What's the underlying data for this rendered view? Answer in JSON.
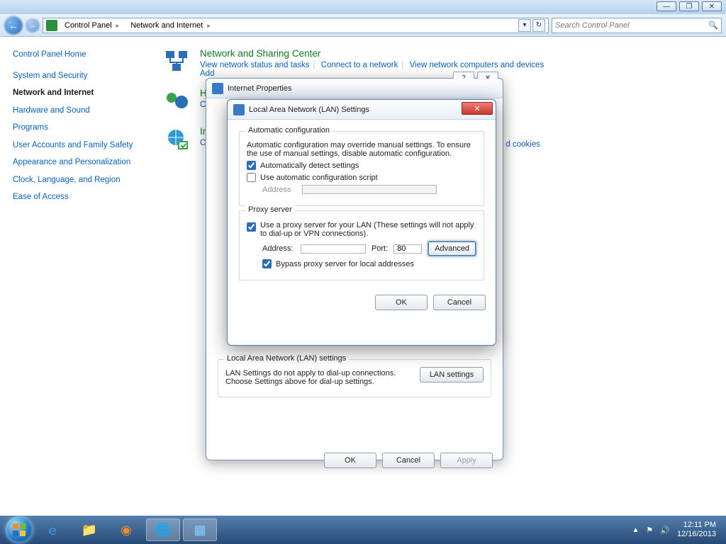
{
  "window": {
    "breadcrumbs": [
      "Control Panel",
      "Network and Internet"
    ],
    "search_placeholder": "Search Control Panel"
  },
  "sidebar": {
    "home": "Control Panel Home",
    "items": [
      "System and Security",
      "Network and Internet",
      "Hardware and Sound",
      "Programs",
      "User Accounts and Family Safety",
      "Appearance and Personalization",
      "Clock, Language, and Region",
      "Ease of Access"
    ],
    "current_index": 1
  },
  "categories": {
    "nsc": {
      "title": "Network and Sharing Center",
      "links": [
        "View network status and tasks",
        "Connect to a network",
        "View network computers and devices",
        "Add"
      ]
    },
    "homegroup": {
      "title_visible": "Ho",
      "link_visible": "Choo"
    },
    "internet": {
      "title_visible": "Inte",
      "link_visible": "Chan",
      "trailing": "d cookies"
    }
  },
  "ip_dialog": {
    "title": "Internet Properties",
    "lan_group_title": "Local Area Network (LAN) settings",
    "lan_text": "LAN Settings do not apply to dial-up connections. Choose Settings above for dial-up settings.",
    "lan_button": "LAN settings",
    "ok": "OK",
    "cancel": "Cancel",
    "apply": "Apply",
    "help": "?",
    "close": "✕"
  },
  "lan_dialog": {
    "title": "Local Area Network (LAN) Settings",
    "auto": {
      "group": "Automatic configuration",
      "text": "Automatic configuration may override manual settings.  To ensure the use of manual settings, disable automatic configuration.",
      "detect": {
        "label": "Automatically detect settings",
        "checked": true
      },
      "script": {
        "label": "Use automatic configuration script",
        "checked": false
      },
      "addr_label": "Address",
      "addr_value": ""
    },
    "proxy": {
      "group": "Proxy server",
      "use": {
        "label": "Use a proxy server for your LAN (These settings will not apply to dial-up or VPN connections).",
        "checked": true
      },
      "addr_label": "Address:",
      "addr_value": "",
      "port_label": "Port:",
      "port_value": "80",
      "advanced": "Advanced",
      "bypass": {
        "label": "Bypass proxy server for local addresses",
        "checked": true
      }
    },
    "ok": "OK",
    "cancel": "Cancel"
  },
  "taskbar": {
    "time": "12:11 PM",
    "date": "12/16/2013"
  }
}
